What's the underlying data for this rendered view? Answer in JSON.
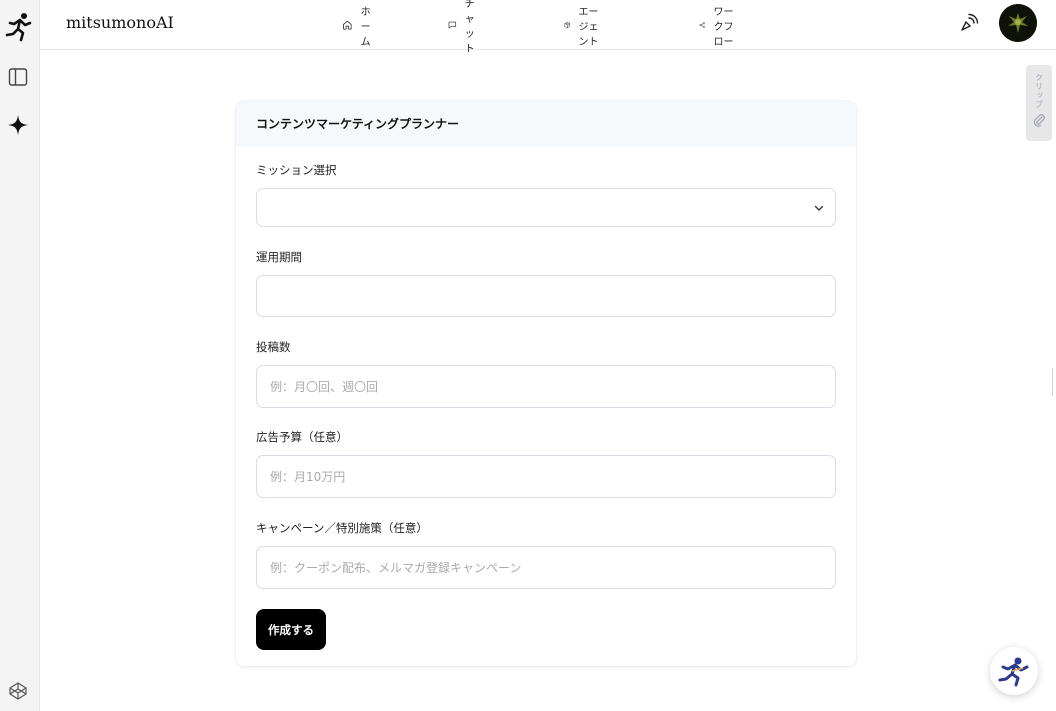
{
  "header": {
    "brand": "mitsumonoAI",
    "nav": [
      {
        "label": "ホーム",
        "icon": "home-icon"
      },
      {
        "label": "チャット",
        "icon": "chat-icon"
      },
      {
        "label": "エージェント",
        "icon": "cube-icon"
      },
      {
        "label": "ワークフロー",
        "icon": "share-icon"
      }
    ]
  },
  "side_tab": {
    "label": "クリップ",
    "icon": "paperclip-icon"
  },
  "form": {
    "title": "コンテンツマーケティングプランナー",
    "mission": {
      "label": "ミッション選択",
      "value": ""
    },
    "period": {
      "label": "運用期間",
      "value": ""
    },
    "posts": {
      "label": "投稿数",
      "placeholder": "例：月〇回、週〇回"
    },
    "ad_budget": {
      "label": "広告予算（任意）",
      "placeholder": "例：月10万円"
    },
    "campaign": {
      "label": "キャンペーン／特別施策（任意）",
      "placeholder": "例：クーポン配布、メルマガ登録キャンペーン"
    },
    "submit_label": "作成する"
  },
  "colors": {
    "primary": "#000000",
    "card_header_bg": "#f6f9fc",
    "rail_bg": "#f4f4f5",
    "border": "#d9dde3",
    "help_accent": "#2b3a8c"
  }
}
